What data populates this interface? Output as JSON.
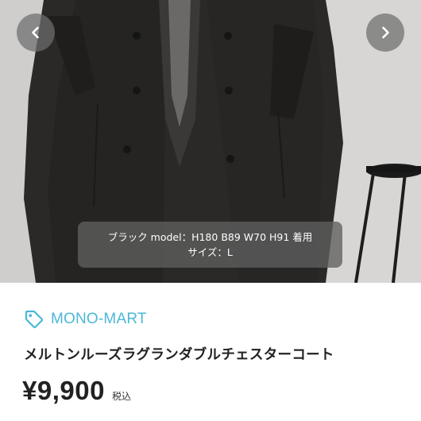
{
  "gallery": {
    "prev_icon": "chevron-left-icon",
    "next_icon": "chevron-right-icon",
    "caption_line1": "ブラック model：H180 B89 W70 H91 着用",
    "caption_line2": "サイズ：L"
  },
  "shop": {
    "icon": "tag-icon",
    "name": "MONO-MART",
    "color": "#4cb8d8"
  },
  "product": {
    "title": "メルトンルーズラグランダブルチェスターコート",
    "price": "¥9,900",
    "tax_label": "税込"
  }
}
